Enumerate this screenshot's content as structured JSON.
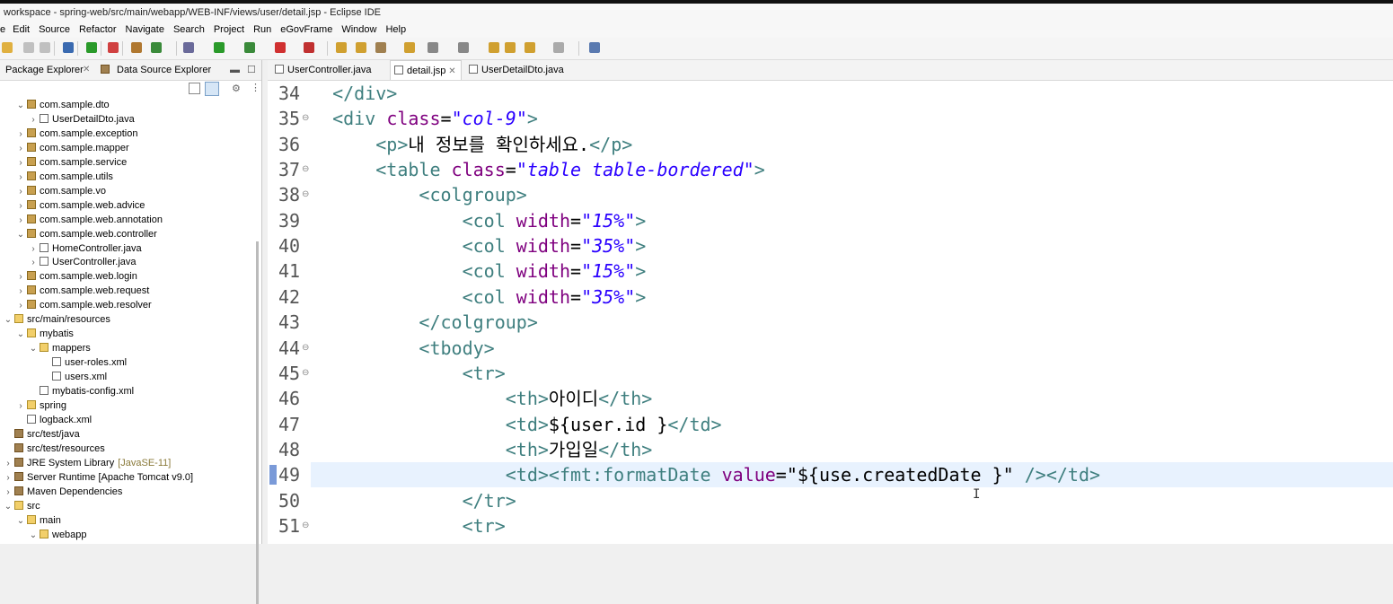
{
  "window": {
    "title": "workspace - spring-web/src/main/webapp/WEB-INF/views/user/detail.jsp - Eclipse IDE"
  },
  "menu": [
    "e",
    "Edit",
    "Source",
    "Refactor",
    "Navigate",
    "Search",
    "Project",
    "Run",
    "eGovFrame",
    "Window",
    "Help"
  ],
  "left_panel": {
    "tabs": [
      "Package Explorer",
      "Data Source Explorer"
    ],
    "tree": [
      {
        "label": "com.sample.dto",
        "type": "pkg",
        "indent": 1,
        "chev": "v"
      },
      {
        "label": "UserDetailDto.java",
        "type": "java",
        "indent": 2,
        "chev": ">"
      },
      {
        "label": "com.sample.exception",
        "type": "pkg",
        "indent": 1,
        "chev": ">"
      },
      {
        "label": "com.sample.mapper",
        "type": "pkg",
        "indent": 1,
        "chev": ">"
      },
      {
        "label": "com.sample.service",
        "type": "pkg",
        "indent": 1,
        "chev": ">"
      },
      {
        "label": "com.sample.utils",
        "type": "pkg",
        "indent": 1,
        "chev": ">"
      },
      {
        "label": "com.sample.vo",
        "type": "pkg",
        "indent": 1,
        "chev": ">"
      },
      {
        "label": "com.sample.web.advice",
        "type": "pkg",
        "indent": 1,
        "chev": ">"
      },
      {
        "label": "com.sample.web.annotation",
        "type": "pkg",
        "indent": 1,
        "chev": ">"
      },
      {
        "label": "com.sample.web.controller",
        "type": "pkg",
        "indent": 1,
        "chev": "v"
      },
      {
        "label": "HomeController.java",
        "type": "java",
        "indent": 2,
        "chev": ">"
      },
      {
        "label": "UserController.java",
        "type": "java",
        "indent": 2,
        "chev": ">"
      },
      {
        "label": "com.sample.web.login",
        "type": "pkg",
        "indent": 1,
        "chev": ">"
      },
      {
        "label": "com.sample.web.request",
        "type": "pkg",
        "indent": 1,
        "chev": ">"
      },
      {
        "label": "com.sample.web.resolver",
        "type": "pkg",
        "indent": 1,
        "chev": ">"
      },
      {
        "label": "src/main/resources",
        "type": "fold",
        "indent": 0,
        "chev": "v"
      },
      {
        "label": "mybatis",
        "type": "fold",
        "indent": 1,
        "chev": "v"
      },
      {
        "label": "mappers",
        "type": "fold",
        "indent": 2,
        "chev": "v"
      },
      {
        "label": "user-roles.xml",
        "type": "xml",
        "indent": 3,
        "chev": ""
      },
      {
        "label": "users.xml",
        "type": "xml",
        "indent": 3,
        "chev": ""
      },
      {
        "label": "mybatis-config.xml",
        "type": "xml",
        "indent": 2,
        "chev": ""
      },
      {
        "label": "spring",
        "type": "fold",
        "indent": 1,
        "chev": ">"
      },
      {
        "label": "logback.xml",
        "type": "xml",
        "indent": 1,
        "chev": ""
      },
      {
        "label": "src/test/java",
        "type": "lib",
        "indent": 0,
        "chev": ""
      },
      {
        "label": "src/test/resources",
        "type": "lib",
        "indent": 0,
        "chev": ""
      },
      {
        "label": "JRE System Library",
        "suffix": "[JavaSE-11]",
        "type": "lib",
        "indent": 0,
        "chev": ">"
      },
      {
        "label": "Server Runtime [Apache Tomcat v9.0]",
        "type": "lib",
        "indent": 0,
        "chev": ">"
      },
      {
        "label": "Maven Dependencies",
        "type": "lib",
        "indent": 0,
        "chev": ">"
      },
      {
        "label": "src",
        "type": "fold",
        "indent": 0,
        "chev": "v"
      },
      {
        "label": "main",
        "type": "fold",
        "indent": 1,
        "chev": "v"
      },
      {
        "label": "webapp",
        "type": "fold",
        "indent": 2,
        "chev": "v"
      }
    ]
  },
  "editor": {
    "tabs": [
      {
        "label": "UserController.java",
        "active": false
      },
      {
        "label": "detail.jsp",
        "active": true
      },
      {
        "label": "UserDetailDto.java",
        "active": false
      }
    ],
    "lines": [
      {
        "n": "34",
        "fold": false,
        "indent": 2,
        "parts": [
          [
            "tag",
            "</div>"
          ]
        ]
      },
      {
        "n": "35",
        "fold": true,
        "indent": 2,
        "parts": [
          [
            "tag",
            "<div "
          ],
          [
            "attr",
            "class"
          ],
          [
            "el",
            "="
          ],
          [
            "val",
            "\"col-9\""
          ],
          [
            "tag",
            ">"
          ]
        ]
      },
      {
        "n": "36",
        "fold": false,
        "indent": 3,
        "parts": [
          [
            "tag",
            "<p>"
          ],
          [
            "txt",
            "내 정보를 확인하세요."
          ],
          [
            "tag",
            "</p>"
          ]
        ]
      },
      {
        "n": "37",
        "fold": true,
        "indent": 3,
        "parts": [
          [
            "tag",
            "<table "
          ],
          [
            "attr",
            "class"
          ],
          [
            "el",
            "="
          ],
          [
            "val",
            "\"table table-bordered\""
          ],
          [
            "tag",
            ">"
          ]
        ]
      },
      {
        "n": "38",
        "fold": true,
        "indent": 4,
        "parts": [
          [
            "tag",
            "<colgroup>"
          ]
        ]
      },
      {
        "n": "39",
        "fold": false,
        "indent": 5,
        "parts": [
          [
            "tag",
            "<col "
          ],
          [
            "attr",
            "width"
          ],
          [
            "el",
            "="
          ],
          [
            "val",
            "\"15%\""
          ],
          [
            "tag",
            ">"
          ]
        ]
      },
      {
        "n": "40",
        "fold": false,
        "indent": 5,
        "parts": [
          [
            "tag",
            "<col "
          ],
          [
            "attr",
            "width"
          ],
          [
            "el",
            "="
          ],
          [
            "val",
            "\"35%\""
          ],
          [
            "tag",
            ">"
          ]
        ]
      },
      {
        "n": "41",
        "fold": false,
        "indent": 5,
        "parts": [
          [
            "tag",
            "<col "
          ],
          [
            "attr",
            "width"
          ],
          [
            "el",
            "="
          ],
          [
            "val",
            "\"15%\""
          ],
          [
            "tag",
            ">"
          ]
        ]
      },
      {
        "n": "42",
        "fold": false,
        "indent": 5,
        "parts": [
          [
            "tag",
            "<col "
          ],
          [
            "attr",
            "width"
          ],
          [
            "el",
            "="
          ],
          [
            "val",
            "\"35%\""
          ],
          [
            "tag",
            ">"
          ]
        ]
      },
      {
        "n": "43",
        "fold": false,
        "indent": 4,
        "parts": [
          [
            "tag",
            "</colgroup>"
          ]
        ]
      },
      {
        "n": "44",
        "fold": true,
        "indent": 4,
        "parts": [
          [
            "tag",
            "<tbody>"
          ]
        ]
      },
      {
        "n": "45",
        "fold": true,
        "indent": 5,
        "parts": [
          [
            "tag",
            "<tr>"
          ]
        ]
      },
      {
        "n": "46",
        "fold": false,
        "indent": 6,
        "parts": [
          [
            "tag",
            "<th>"
          ],
          [
            "txt",
            "아이디"
          ],
          [
            "tag",
            "</th>"
          ]
        ]
      },
      {
        "n": "47",
        "fold": false,
        "indent": 6,
        "parts": [
          [
            "tag",
            "<td>"
          ],
          [
            "txt",
            "${user.id }"
          ],
          [
            "tag",
            "</td>"
          ]
        ]
      },
      {
        "n": "48",
        "fold": false,
        "indent": 6,
        "parts": [
          [
            "tag",
            "<th>"
          ],
          [
            "txt",
            "가입일"
          ],
          [
            "tag",
            "</th>"
          ]
        ]
      },
      {
        "n": "49",
        "fold": false,
        "indent": 6,
        "highlight": true,
        "parts": [
          [
            "tag",
            "<td><fmt:formatDate "
          ],
          [
            "attr",
            "value"
          ],
          [
            "el",
            "="
          ],
          [
            "el",
            "\""
          ],
          [
            "txt",
            "${use.createdDate }"
          ],
          [
            "el",
            "\""
          ],
          [
            "tag",
            " /></td>"
          ]
        ]
      },
      {
        "n": "50",
        "fold": false,
        "indent": 5,
        "parts": [
          [
            "tag",
            "</tr>"
          ]
        ]
      },
      {
        "n": "51",
        "fold": true,
        "indent": 5,
        "parts": [
          [
            "tag",
            "<tr>"
          ]
        ]
      }
    ]
  },
  "colors": {
    "tag": "#3f7f7f",
    "attr": "#7f007f",
    "value": "#2a00ff",
    "highlight": "#e8f2fe"
  }
}
